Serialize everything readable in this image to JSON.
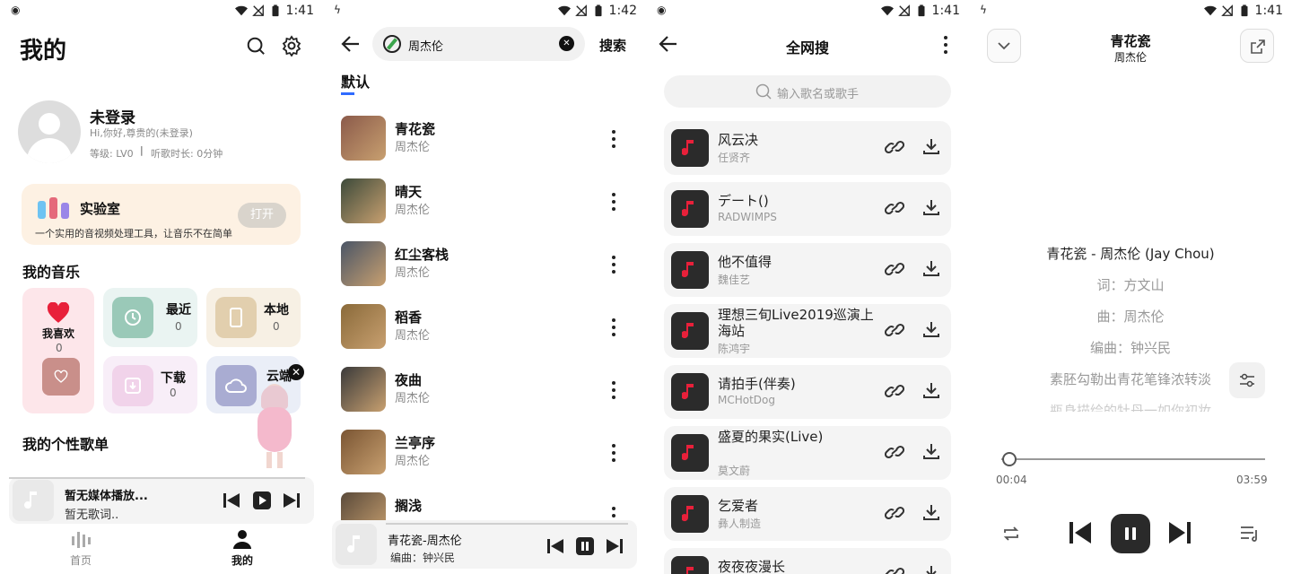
{
  "p1": {
    "status_time": "1:41",
    "title": "我的",
    "user": {
      "name": "未登录",
      "greeting": "Hi,你好,尊贵的(未登录)",
      "level": "等级: LV0",
      "listen": "听歌时长: 0分钟"
    },
    "lab": {
      "title": "实验室",
      "desc": "一个实用的音视频处理工具，让音乐不在简单",
      "button": "打开"
    },
    "my_music": "我的音乐",
    "tiles": {
      "fav": {
        "name": "我喜欢",
        "count": "0"
      },
      "recent": {
        "name": "最近",
        "count": "0"
      },
      "local": {
        "name": "本地",
        "count": "0"
      },
      "download": {
        "name": "下载",
        "count": "0"
      },
      "cloud": {
        "name": "云端"
      }
    },
    "playlist_title": "我的个性歌单",
    "mini_player": {
      "title": "暂无媒体播放...",
      "subtitle": "暂无歌词.."
    },
    "nav": {
      "home": "首页",
      "mine": "我的"
    }
  },
  "p2": {
    "status_time": "1:42",
    "search_value": "周杰伦",
    "search_button": "搜索",
    "tab": "默认",
    "accent": "#2f6bff",
    "songs": [
      {
        "name": "青花瓷",
        "artist": "周杰伦"
      },
      {
        "name": "晴天",
        "artist": "周杰伦"
      },
      {
        "name": "红尘客栈",
        "artist": "周杰伦"
      },
      {
        "name": "稻香",
        "artist": "周杰伦"
      },
      {
        "name": "夜曲",
        "artist": "周杰伦"
      },
      {
        "name": "兰亭序",
        "artist": "周杰伦"
      },
      {
        "name": "搁浅",
        "artist": ""
      }
    ],
    "mini_player": {
      "title": "青花瓷-周杰伦",
      "subtitle": "编曲：钟兴民"
    }
  },
  "p3": {
    "status_time": "1:41",
    "title": "全网搜",
    "search_placeholder": "输入歌名或歌手",
    "results": [
      {
        "name": "风云决",
        "artist": "任贤齐"
      },
      {
        "name": "デート()",
        "artist": "RADWIMPS"
      },
      {
        "name": "他不值得",
        "artist": "魏佳艺"
      },
      {
        "name": "理想三旬Live2019巡演上海站",
        "artist": "陈鸿宇"
      },
      {
        "name": "请拍手(伴奏)",
        "artist": "MCHotDog"
      },
      {
        "name": "盛夏的果实(Live)",
        "artist": "莫文蔚"
      },
      {
        "name": "乞爱者",
        "artist": "彝人制造"
      },
      {
        "name": "夜夜夜漫长",
        "artist": ""
      }
    ]
  },
  "p4": {
    "status_time": "1:41",
    "song_title": "青花瓷",
    "artist": "周杰伦",
    "lyrics": [
      "青花瓷 - 周杰伦 (Jay Chou)",
      "词：方文山",
      "曲：周杰伦",
      "编曲：钟兴民",
      "素胚勾勒出青花笔锋浓转淡",
      "瓶身描绘的牡丹一如你初妆"
    ],
    "time_current": "00:04",
    "time_total": "03:59",
    "progress": 0.017
  }
}
